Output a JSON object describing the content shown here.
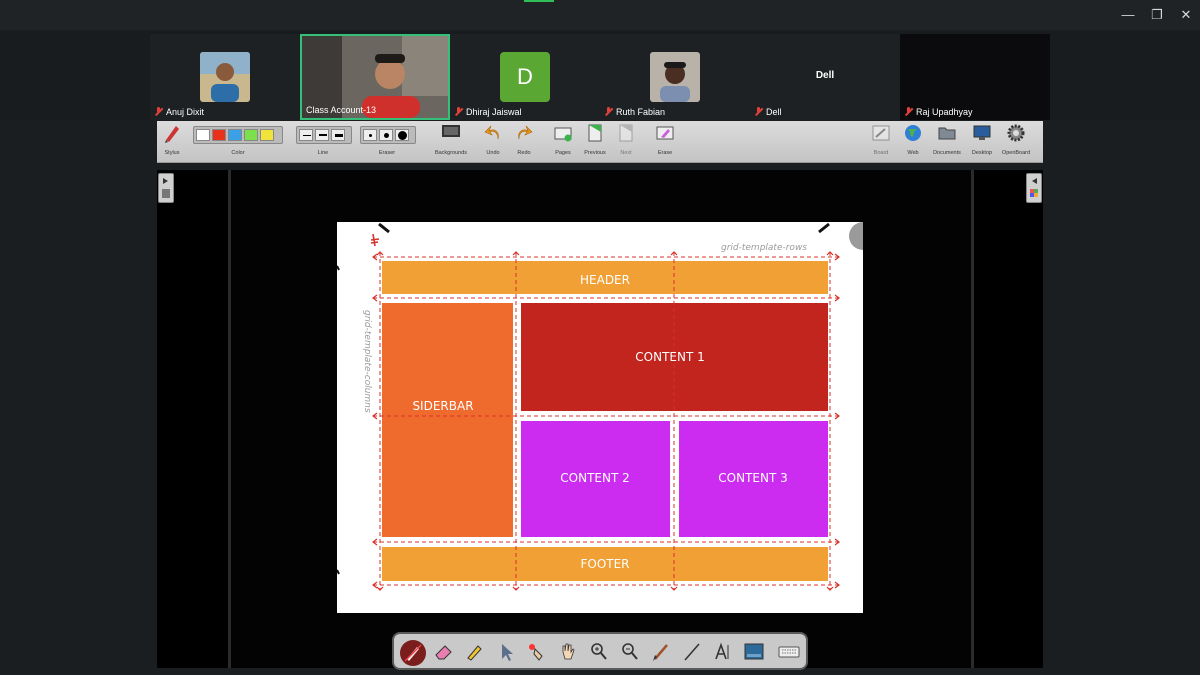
{
  "window": {
    "minimize": "—",
    "restore": "❐",
    "close": "✕"
  },
  "participants": [
    {
      "name": "Anuj Dixit",
      "muted": true
    },
    {
      "name": "Class Account-13",
      "muted": false,
      "active": true
    },
    {
      "name": "Dhiraj Jaiswal",
      "muted": true,
      "initial": "D"
    },
    {
      "name": "Ruth Fabian",
      "muted": true
    },
    {
      "name": "Dell",
      "muted": true,
      "center_label": "Dell"
    },
    {
      "name": "Raj Upadhyay",
      "muted": true
    }
  ],
  "toolbar": {
    "stylus": "Stylus",
    "color": "Color",
    "line": "Line",
    "eraser": "Eraser",
    "backgrounds": "Backgrounds",
    "undo": "Undo",
    "redo": "Redo",
    "pages": "Pages",
    "previous": "Previous",
    "next": "Next",
    "erase": "Erase",
    "board": "Board",
    "web": "Web",
    "documents": "Documents",
    "desktop": "Desktop",
    "openboard": "OpenBoard",
    "colors": [
      "#ffffff",
      "#e8321c",
      "#3aa0e8",
      "#7ce04a",
      "#f0e43a"
    ]
  },
  "slide": {
    "rows_label": "grid-template-rows",
    "columns_label": "grid-template-columns",
    "header": "HEADER",
    "sidebar": "SIDERBAR",
    "content1": "CONTENT 1",
    "content2": "CONTENT 2",
    "content3": "CONTENT 3",
    "footer": "FOOTER",
    "colors": {
      "header": "#f0a035",
      "sidebar": "#ef6b2d",
      "content1": "#c1251d",
      "content2": "#cc2cf0",
      "content3": "#cc2cf0",
      "footer": "#f0a035",
      "guides": "#d9312b"
    }
  },
  "palette": {
    "items": [
      "pen-icon",
      "eraser-icon",
      "marker-icon",
      "pointer-icon",
      "laser-icon",
      "hand-icon",
      "zoom-in-icon",
      "zoom-out-icon",
      "brush-icon",
      "line-icon",
      "text-icon",
      "capture-icon",
      "keyboard-icon"
    ]
  }
}
